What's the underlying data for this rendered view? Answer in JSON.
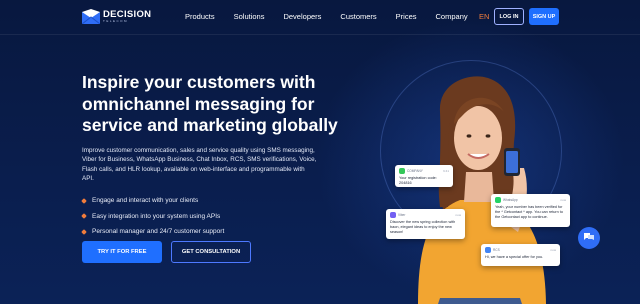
{
  "brand": {
    "name": "DECISION",
    "sub": "TELECOM"
  },
  "nav": {
    "items": [
      "Products",
      "Solutions",
      "Developers",
      "Customers",
      "Prices",
      "Company"
    ],
    "lang": "EN",
    "login": "LOG IN",
    "signup": "SIGN UP"
  },
  "hero": {
    "title": "Inspire your customers with omnichannel messaging for service and marketing globally",
    "description": "Improve customer communication, sales and service quality using SMS messaging, Viber for Business, WhatsApp Business, Chat Inbox, RCS, SMS verifications, Voice, Flash calls, and HLR lookup, available on web-interface and programmable with API.",
    "features": [
      "Engage and interact with your clients",
      "Easy integration into your system using APIs",
      "Personal manager and 24/7 customer support"
    ],
    "cta_primary": "TRY IT FOR FREE",
    "cta_secondary": "GET CONSULTATION"
  },
  "cards": {
    "sms": {
      "app": "COMPANY",
      "time": "9:41",
      "msg": "Your registration code: 204816"
    },
    "whatsapp": {
      "app": "WhatsApp",
      "time": "now",
      "msg": "Yeah, your number has been verified for the * Getcontact * app. You can return to the Getcontact app to continue."
    },
    "viber": {
      "app": "Viber",
      "time": "now",
      "msg": "Discover the new spring collection with baon, elegant ideas to enjoy the new season!"
    },
    "rcs": {
      "app": "RCS",
      "time": "now",
      "msg": "Hi, we have a special offer for you."
    }
  },
  "colors": {
    "accent": "#1f6fff",
    "orange": "#f07c3c",
    "bg": "#081a45"
  }
}
